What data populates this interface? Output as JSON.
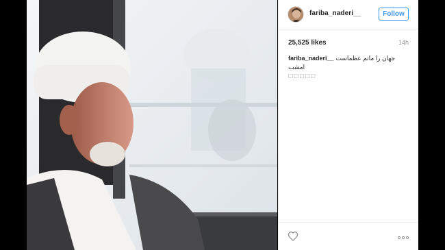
{
  "post": {
    "username": "fariba_naderi__",
    "follow_label": "Follow",
    "likes": "25,525 likes",
    "time": "14h",
    "caption_user": "fariba_naderi__",
    "caption_text": "جهان را ماتم عظماست امشب",
    "caption_emoji": "☐☐☐☐☐"
  },
  "icons": {
    "heart": "heart-outline-icon",
    "more": "more-options-icon"
  },
  "colors": {
    "accent": "#3897f0",
    "text": "#262626",
    "muted": "#999999",
    "border": "#efefef"
  }
}
